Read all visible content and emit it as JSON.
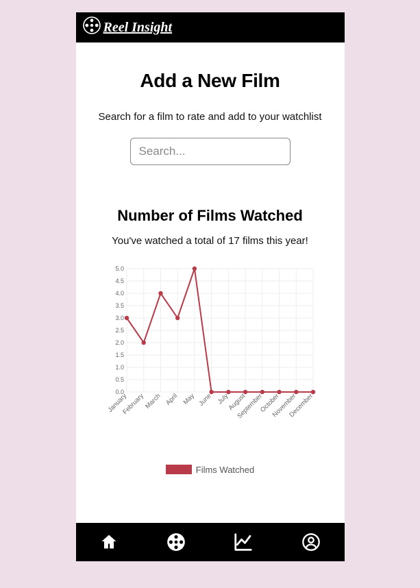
{
  "header": {
    "brand": "Reel Insight"
  },
  "add": {
    "title": "Add a New Film",
    "subtitle": "Search for a film to rate and add to your watchlist",
    "search_placeholder": "Search..."
  },
  "stats": {
    "title": "Number of Films Watched",
    "summary": "You've watched a total of 17 films this year!"
  },
  "chart_data": {
    "type": "line",
    "title": "Number of Films Watched",
    "xlabel": "",
    "ylabel": "",
    "categories": [
      "January",
      "February",
      "March",
      "April",
      "May",
      "June",
      "July",
      "August",
      "September",
      "October",
      "November",
      "December"
    ],
    "series": [
      {
        "name": "Films Watched",
        "values": [
          3,
          2,
          4,
          3,
          5,
          0,
          0,
          0,
          0,
          0,
          0,
          0
        ]
      }
    ],
    "ylim": [
      0,
      5
    ],
    "ytick_step": 0.5,
    "legend": {
      "position": "bottom",
      "entries": [
        "Films Watched"
      ]
    },
    "grid": true,
    "color": "#b83b4a"
  },
  "legend_label": "Films Watched",
  "nav": {
    "items": [
      "home",
      "films",
      "stats",
      "profile"
    ]
  }
}
